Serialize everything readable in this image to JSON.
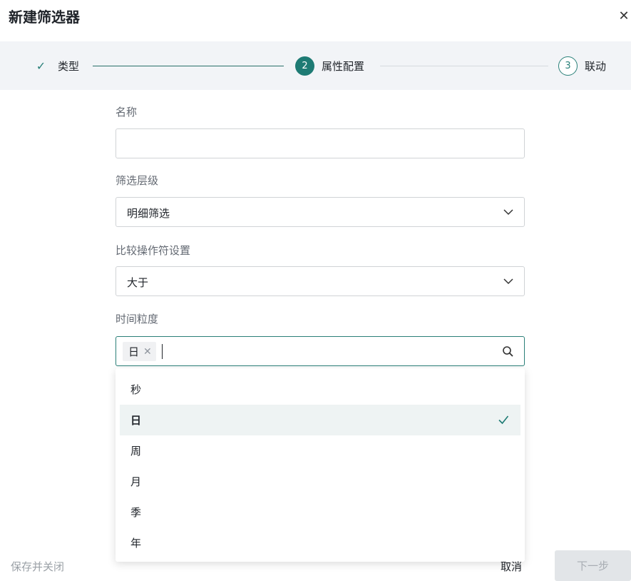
{
  "dialog": {
    "title": "新建筛选器",
    "close_glyph": "✕"
  },
  "steps": [
    {
      "number": "✓",
      "label": "类型"
    },
    {
      "number": "2",
      "label": "属性配置"
    },
    {
      "number": "3",
      "label": "联动"
    }
  ],
  "form": {
    "name": {
      "label": "名称",
      "value": ""
    },
    "level": {
      "label": "筛选层级",
      "value": "明细筛选"
    },
    "operator": {
      "label": "比较操作符设置",
      "value": "大于"
    },
    "granularity": {
      "label": "时间粒度",
      "tag": "日",
      "tag_remove": "✕"
    }
  },
  "dropdown": {
    "options": [
      "秒",
      "日",
      "周",
      "月",
      "季",
      "年"
    ]
  },
  "footer": {
    "save_close": "保存并关闭",
    "cancel": "取消",
    "next": "下一步"
  },
  "colors": {
    "accent": "#1e7b74",
    "selected_bg": "#eef3f3"
  }
}
